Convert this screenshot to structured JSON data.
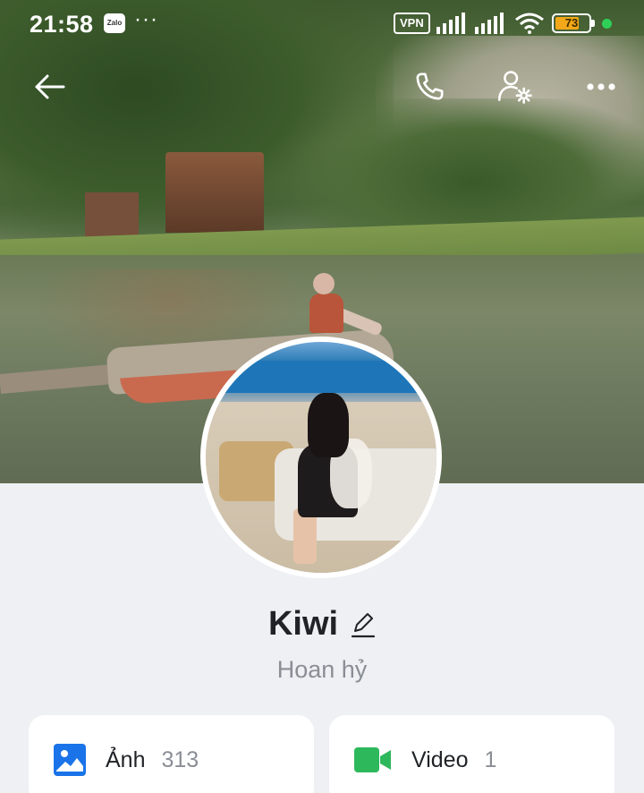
{
  "status_bar": {
    "time": "21:58",
    "app_badge": "Zalo",
    "more_dots": "···",
    "vpn": "VPN",
    "battery_level": "73",
    "battery_fill_fraction": 0.73,
    "battery_color": "#f2a818",
    "indicator_color": "#2fd057"
  },
  "header": {
    "back_icon": "arrow-left-icon",
    "call_icon": "phone-icon",
    "settings_icon": "user-settings-icon",
    "more_icon": "more-horizontal-icon"
  },
  "profile": {
    "name": "Kiwi",
    "edit_icon": "pencil-icon",
    "bio": "Hoan hỷ"
  },
  "media_cards": [
    {
      "label": "Ảnh",
      "count": "313",
      "icon": "image-icon",
      "icon_color": "#1a73e8"
    },
    {
      "label": "Video",
      "count": "1",
      "icon": "video-camera-icon",
      "icon_color": "#2eb85c"
    }
  ]
}
